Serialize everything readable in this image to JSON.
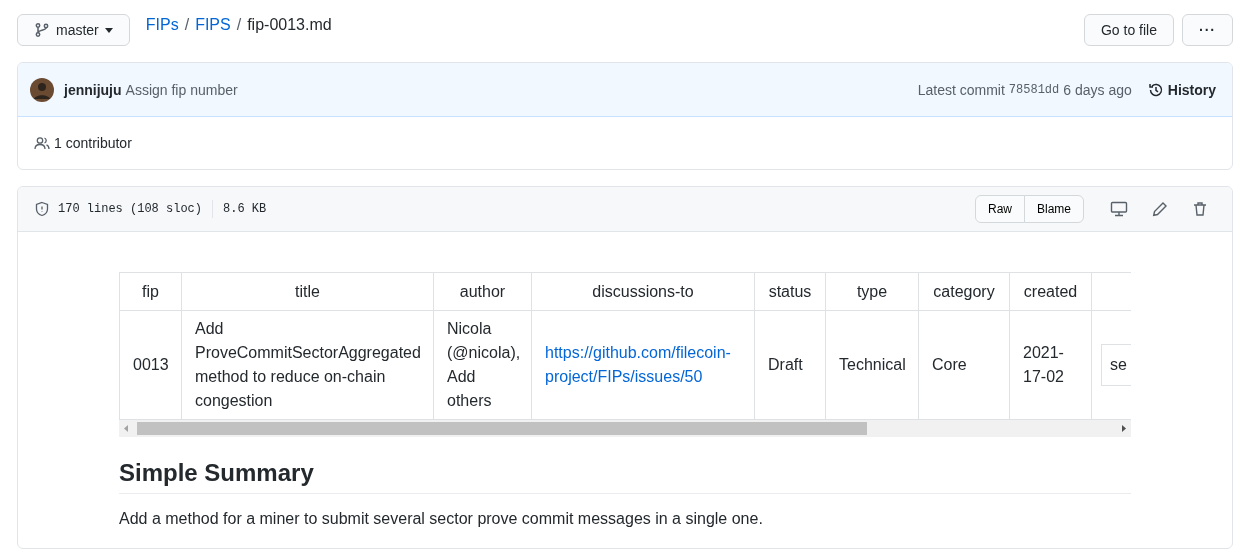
{
  "branch": {
    "name": "master"
  },
  "breadcrumb": [
    {
      "label": "FIPs",
      "kind": "link"
    },
    {
      "label": "/",
      "kind": "separator"
    },
    {
      "label": "FIPS",
      "kind": "link"
    },
    {
      "label": "/",
      "kind": "separator"
    },
    {
      "label": "fip-0013.md",
      "kind": "current"
    }
  ],
  "actions": {
    "go_to_file": "Go to file",
    "more": "···"
  },
  "commit": {
    "author": "jennijuju",
    "message": "Assign fip number",
    "latest_label": "Latest commit",
    "sha": "78581dd",
    "age": "6 days ago",
    "history": "History"
  },
  "contributors": "1 contributor",
  "file_info": {
    "lines": "170 lines (108 sloc)",
    "size": "8.6 KB",
    "buttons": [
      "Raw",
      "Blame"
    ]
  },
  "table": {
    "columns": [
      "fip",
      "title",
      "author",
      "discussions-to",
      "status",
      "type",
      "category",
      "created",
      ""
    ],
    "rows": [
      [
        {
          "text": "0013",
          "kind": "text"
        },
        {
          "text": "Add ProveCommitSectorAggregated method to reduce on-chain congestion",
          "kind": "text"
        },
        {
          "text": "Nicola (@nicola), Add others",
          "kind": "text"
        },
        {
          "text": "https://github.com/filecoin-project/FIPs/issues/50",
          "kind": "link"
        },
        {
          "text": "Draft",
          "kind": "text"
        },
        {
          "text": "Technical",
          "kind": "text"
        },
        {
          "text": "Core",
          "kind": "text"
        },
        {
          "text": "2021-17-02",
          "kind": "text"
        },
        {
          "text": "se",
          "kind": "boxed"
        }
      ]
    ]
  },
  "section": {
    "heading": "Simple Summary",
    "text": "Add a method for a miner to submit several sector prove commit messages in a single one."
  }
}
